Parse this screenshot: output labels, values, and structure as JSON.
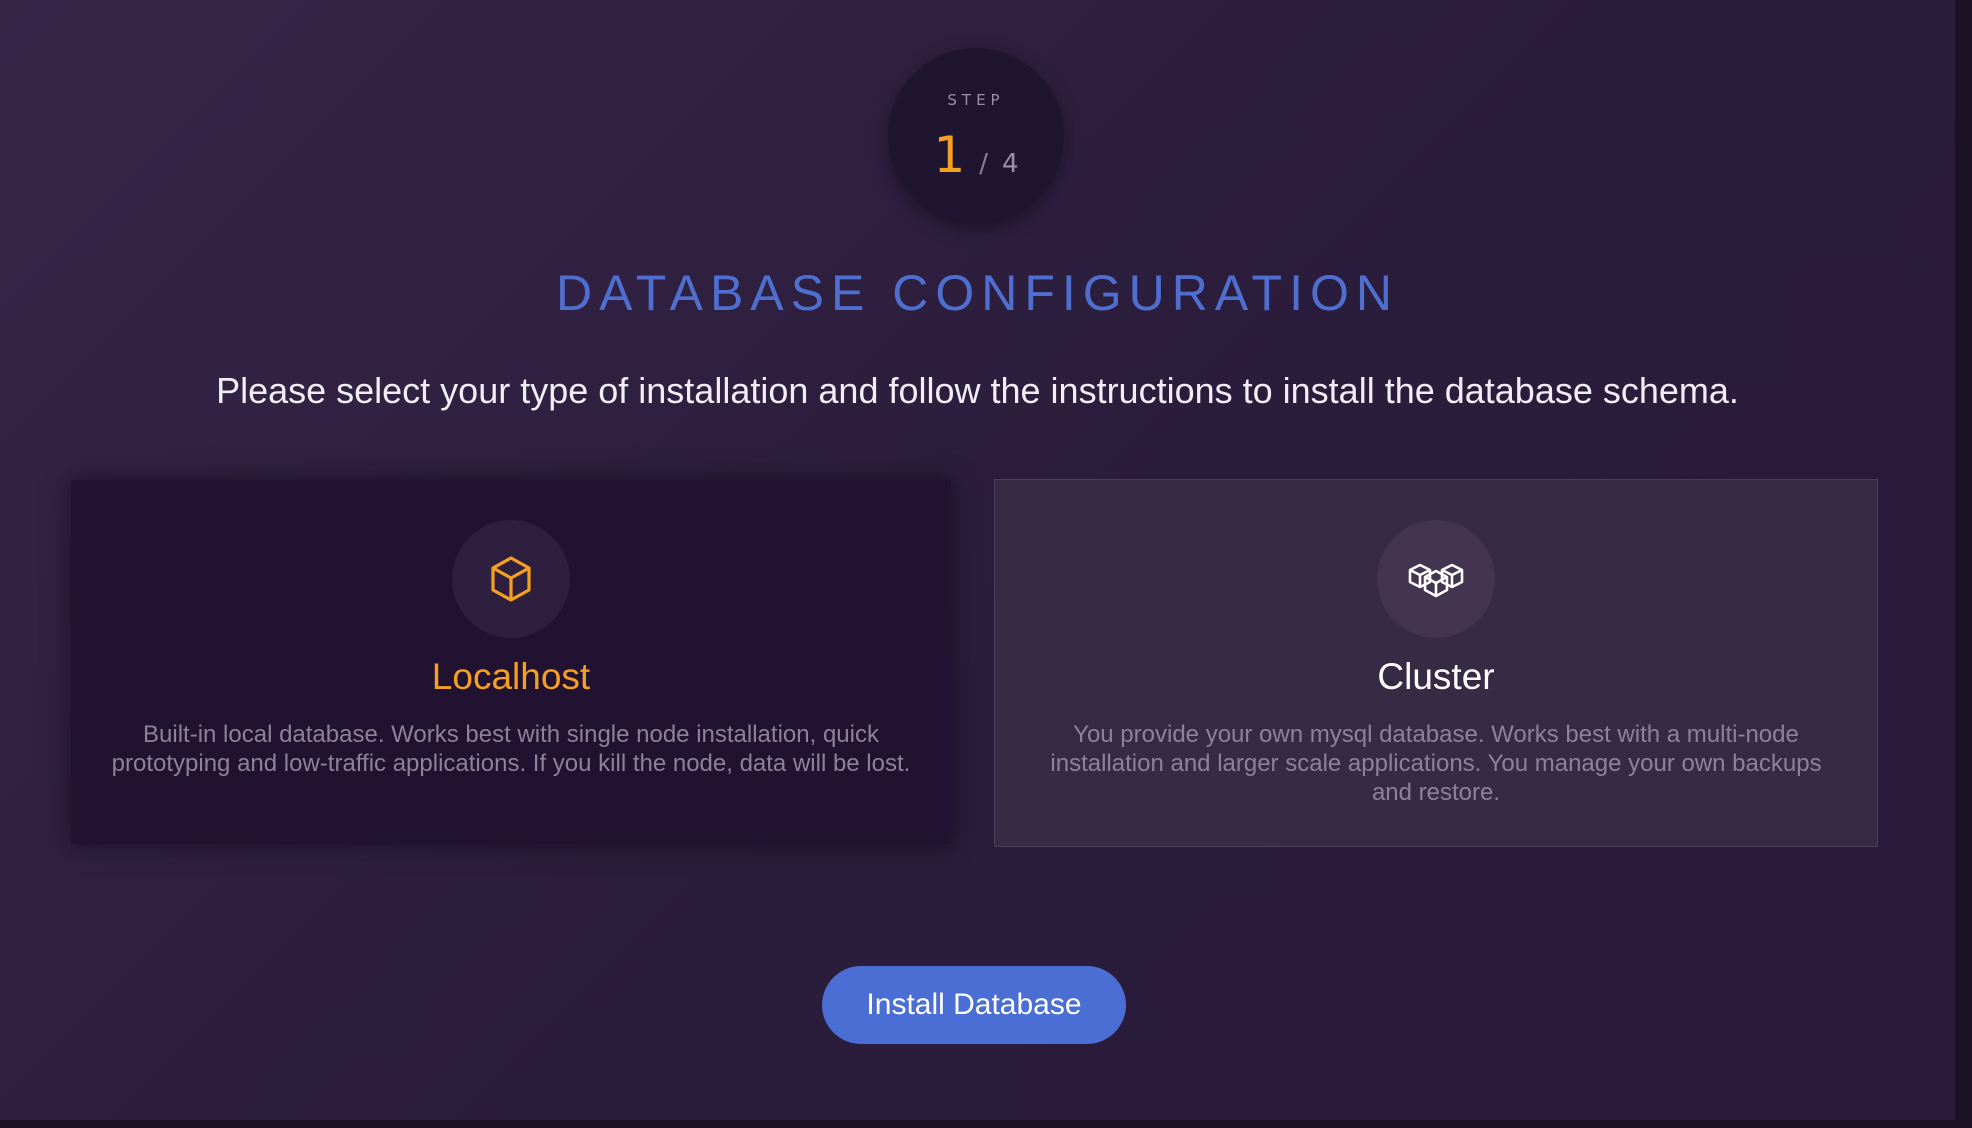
{
  "step": {
    "label": "STEP",
    "current": "1",
    "separator": "/",
    "total": "4"
  },
  "page": {
    "title": "DATABASE CONFIGURATION",
    "subtitle": "Please select your type of installation and follow the instructions to install the database schema."
  },
  "options": [
    {
      "title": "Localhost",
      "description": "Built-in local database. Works best with single node installation, quick prototyping and low-traffic applications. If you kill the node, data will be lost.",
      "icon": "cube-icon",
      "selected": true
    },
    {
      "title": "Cluster",
      "description": "You provide your own mysql database. Works best with a multi-node installation and larger scale applications. You manage your own backups and restore.",
      "icon": "cubes-icon",
      "selected": false
    }
  ],
  "actions": {
    "install_label": "Install Database"
  },
  "colors": {
    "accent": "#f5a020",
    "primary": "#4a6ed3",
    "background": "#2a1c3b"
  }
}
